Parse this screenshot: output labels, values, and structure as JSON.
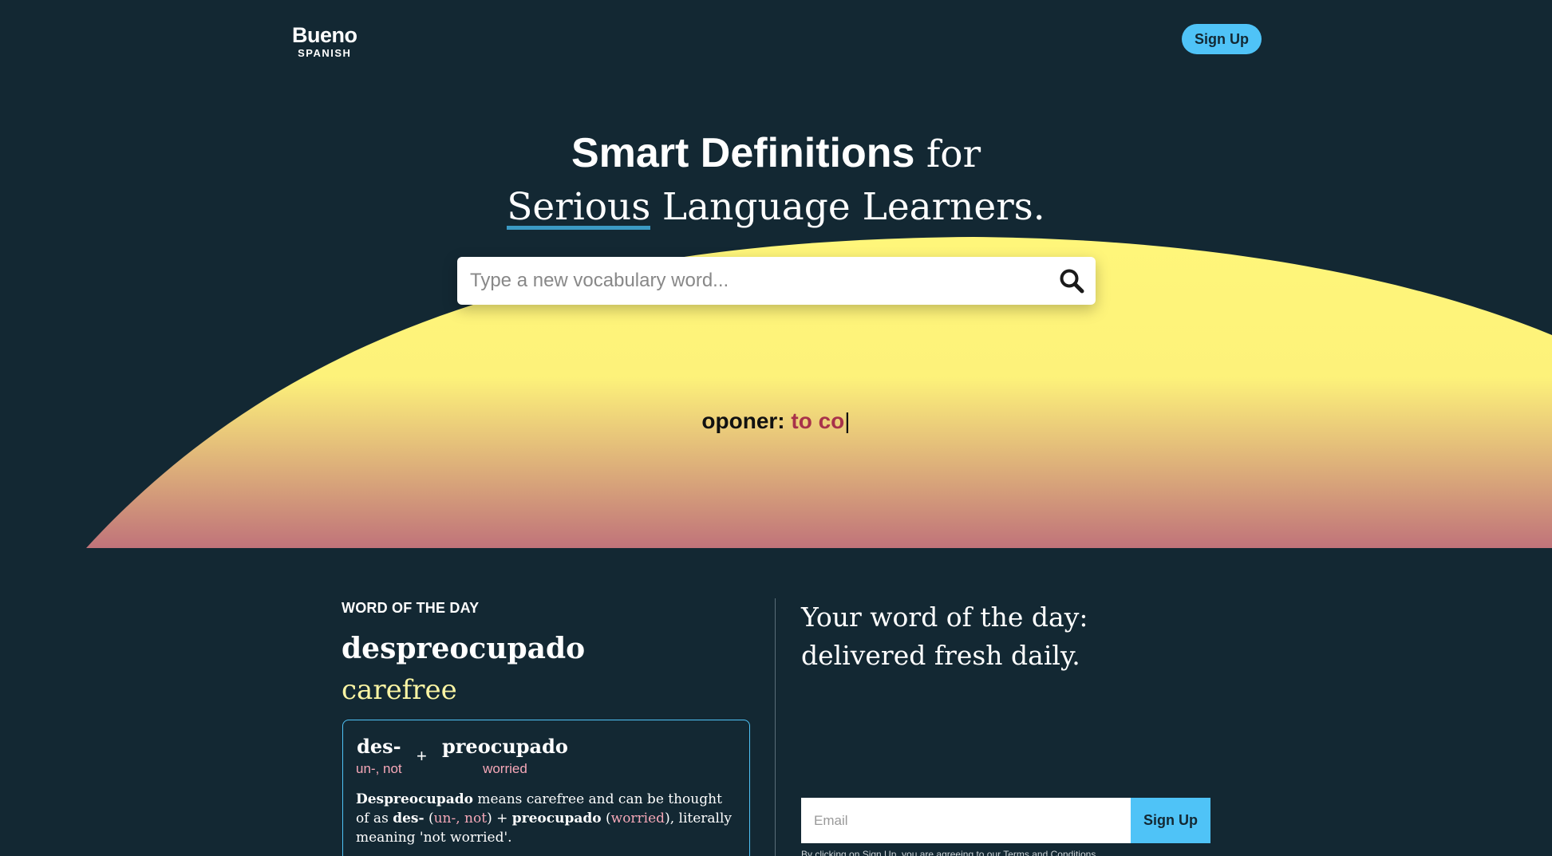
{
  "header": {
    "logo_main": "Bueno",
    "logo_sub": "SPANISH",
    "signup_label": "Sign Up"
  },
  "hero": {
    "headline_bold": "Smart Definitions",
    "headline_for": "for",
    "headline_serious": "Serious",
    "headline_rest": "Language Learners.",
    "search_placeholder": "Type a new vocabulary word...",
    "typing_word": "oponer:",
    "typing_definition": "to co",
    "typing_cursor": "|",
    "gradient_top": "#fff67a",
    "gradient_bottom": "#c0737a"
  },
  "word_of_day": {
    "label": "WORD OF THE DAY",
    "word": "despreocupado",
    "translation": "carefree",
    "morphemes": [
      {
        "root": "des-",
        "gloss": "un-, not"
      },
      {
        "root": "preocupado",
        "gloss": "worried"
      }
    ],
    "plus": "+",
    "explanation": {
      "p1_word": "Despreocupado",
      "p1_text": " means carefree and can be thought of as ",
      "p2_root": "des-",
      "p2_open": " (",
      "p2_gloss": "un-, not",
      "p2_close": ") + ",
      "p3_root": "preocupado",
      "p3_open": " (",
      "p3_gloss": "worried",
      "p3_close": "), literally meaning 'not worried'."
    }
  },
  "promo": {
    "title": "Your word of the day: delivered fresh daily.",
    "email_placeholder": "Email",
    "signup_label": "Sign Up",
    "terms": "By clicking on Sign Up, you are agreeing to our Terms and Conditions."
  },
  "colors": {
    "background": "#132833",
    "accent": "#4fc3f7",
    "highlight": "#fbf5a4",
    "gloss_pink": "#f6a8b8",
    "typing_red": "#a8324a"
  }
}
